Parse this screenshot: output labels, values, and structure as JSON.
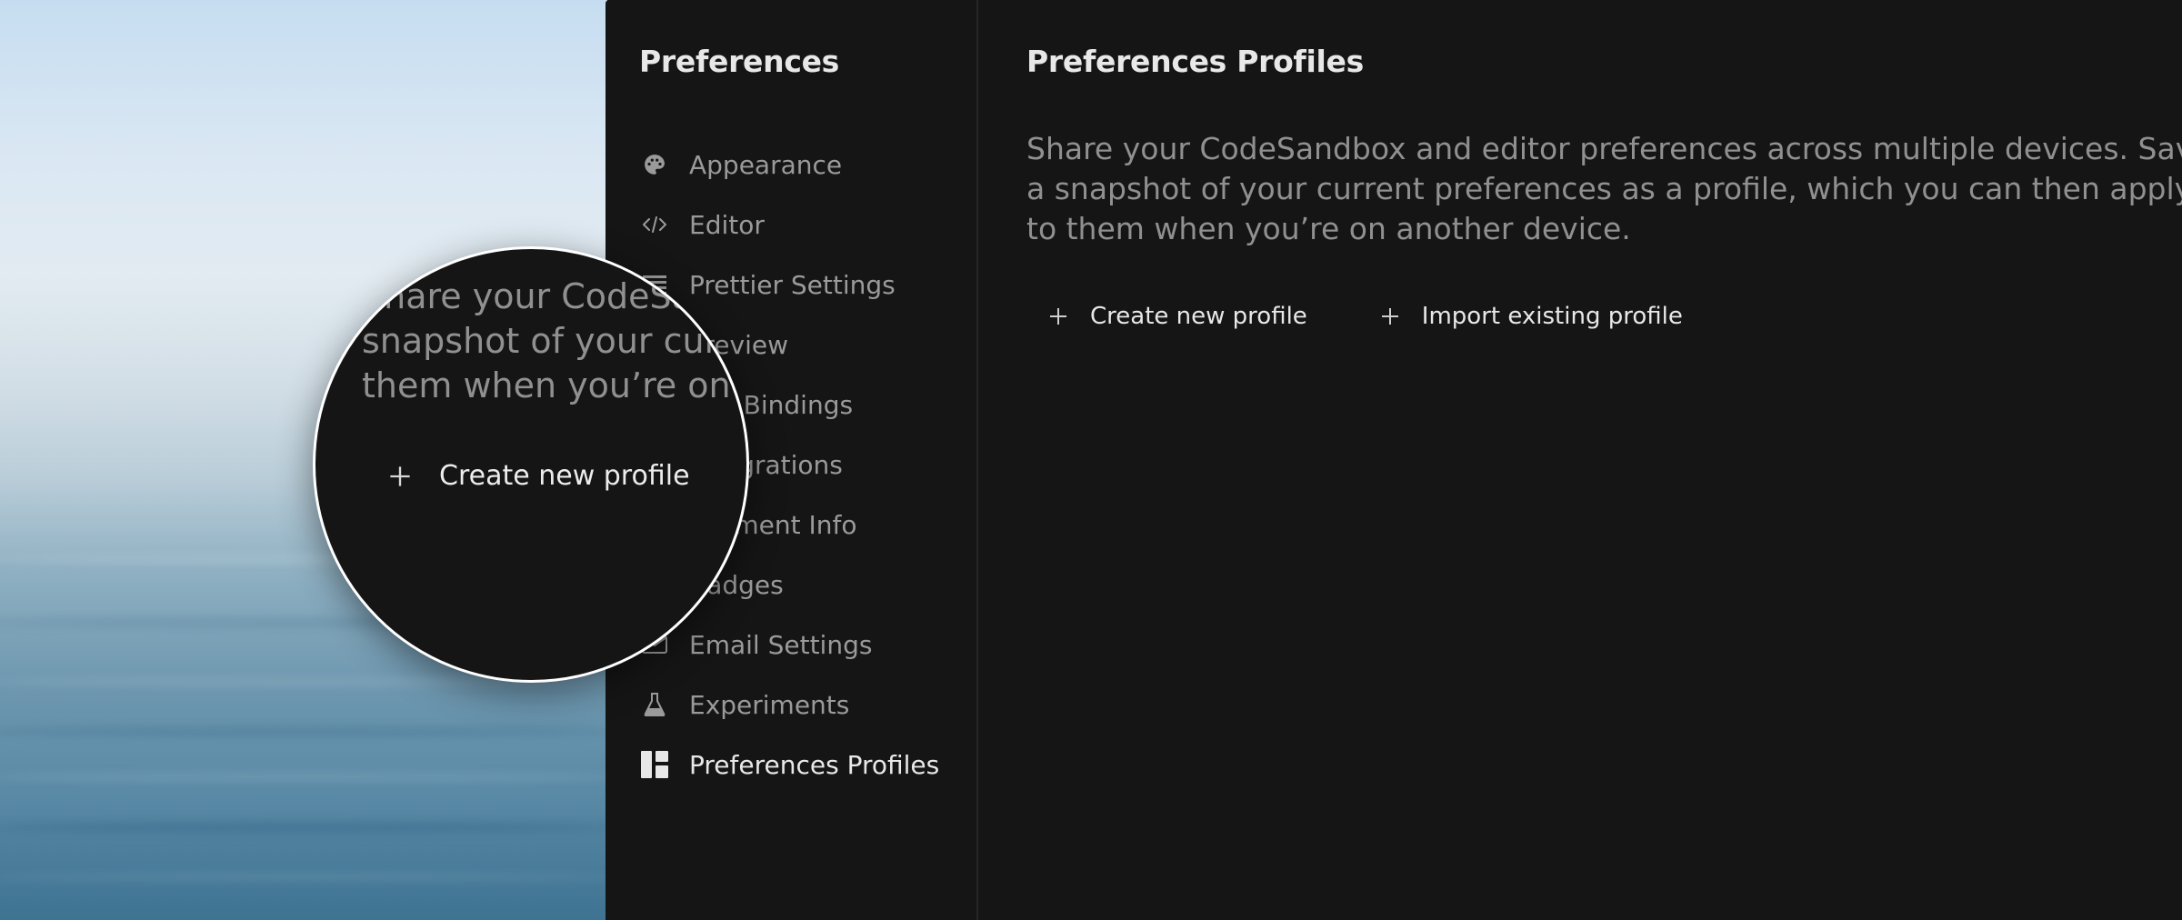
{
  "sidebar": {
    "title": "Preferences",
    "items": [
      {
        "label": "Appearance",
        "icon": "palette-icon"
      },
      {
        "label": "Editor",
        "icon": "code-icon"
      },
      {
        "label": "Prettier Settings",
        "icon": "lines-icon"
      },
      {
        "label": "Preview",
        "icon": "preview-icon"
      },
      {
        "label": "Key Bindings",
        "icon": "keyboard-icon"
      },
      {
        "label": "Integrations",
        "icon": "plug-icon"
      },
      {
        "label": "Payment Info",
        "icon": "card-icon"
      },
      {
        "label": "Badges",
        "icon": "badge-icon"
      },
      {
        "label": "Email Settings",
        "icon": "mail-icon"
      },
      {
        "label": "Experiments",
        "icon": "flask-icon"
      },
      {
        "label": "Preferences Profiles",
        "icon": "layout-icon",
        "active": true
      }
    ]
  },
  "main": {
    "title": "Preferences Profiles",
    "description": "Share your CodeSandbox and editor preferences across multiple devices. Save a snapshot of your current preferences as a profile, which you can then apply to them when you’re on another device.",
    "create_label": "Create new profile",
    "import_label": "Import existing profile"
  },
  "magnifier": {
    "lines": [
      "Share your CodeSandbox and editor",
      "snapshot of your current preferences",
      "them when you’re on another device."
    ],
    "button_label": "Create new profile"
  },
  "colors": {
    "panel_bg": "#151515",
    "text_primary": "#e8e8e8",
    "text_secondary": "#9a9a9a",
    "divider": "#252525"
  }
}
